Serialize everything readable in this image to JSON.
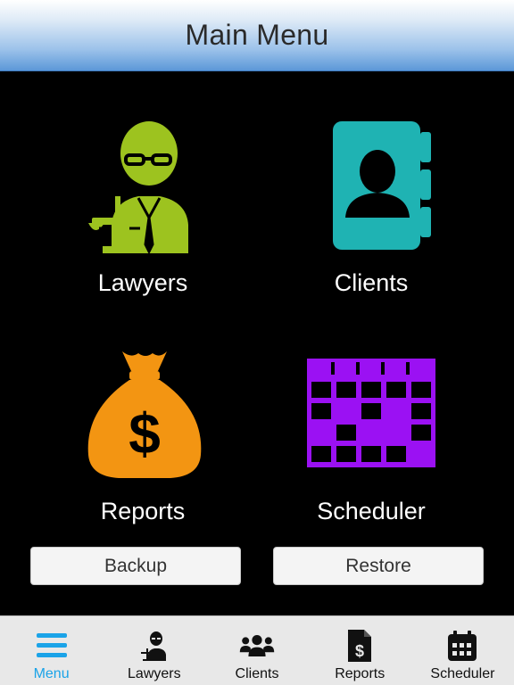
{
  "header": {
    "title": "Main Menu"
  },
  "tiles": {
    "lawyers": {
      "label": "Lawyers",
      "icon": "lawyer-icon",
      "color": "#9dc31f"
    },
    "clients": {
      "label": "Clients",
      "icon": "contact-book-icon",
      "color": "#1fb3b3"
    },
    "reports": {
      "label": "Reports",
      "icon": "money-bag-icon",
      "color": "#f39512"
    },
    "scheduler": {
      "label": "Scheduler",
      "icon": "calendar-icon",
      "color": "#9b11f3"
    }
  },
  "buttons": {
    "backup": "Backup",
    "restore": "Restore"
  },
  "tabbar": {
    "active": "menu",
    "active_color": "#1aa3e8",
    "items": [
      {
        "label": "Menu",
        "icon": "hamburger-menu-icon"
      },
      {
        "label": "Lawyers",
        "icon": "lawyer-icon"
      },
      {
        "label": "Clients",
        "icon": "group-icon"
      },
      {
        "label": "Reports",
        "icon": "report-document-icon"
      },
      {
        "label": "Scheduler",
        "icon": "calendar-icon"
      }
    ]
  }
}
